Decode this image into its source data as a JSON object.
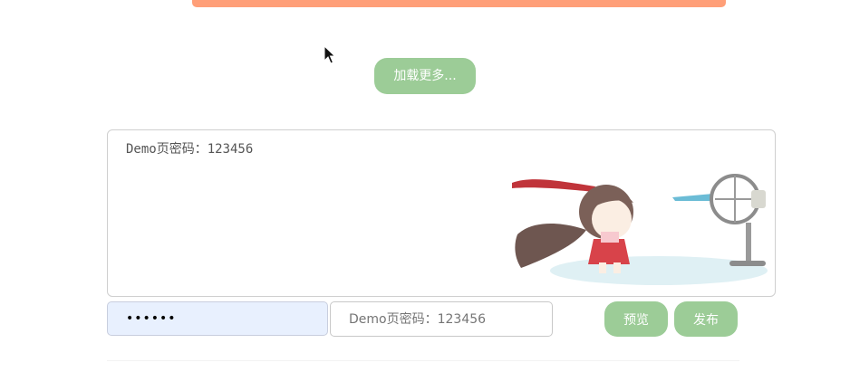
{
  "colors": {
    "top_bar": "#ff9f78",
    "button_bg": "#9ccc97",
    "button_text": "#ffffff",
    "autofill_bg": "#e8f0fe"
  },
  "load_more": {
    "label": "加载更多..."
  },
  "comment": {
    "text": "Demo页密码：123456",
    "illustration": "girl-blown-by-electric-fan"
  },
  "form": {
    "password_value": "••••••",
    "name_placeholder": "Demo页密码：123456"
  },
  "actions": {
    "preview_label": "预览",
    "publish_label": "发布"
  },
  "icons": {
    "cursor": "mouse-pointer-icon"
  }
}
